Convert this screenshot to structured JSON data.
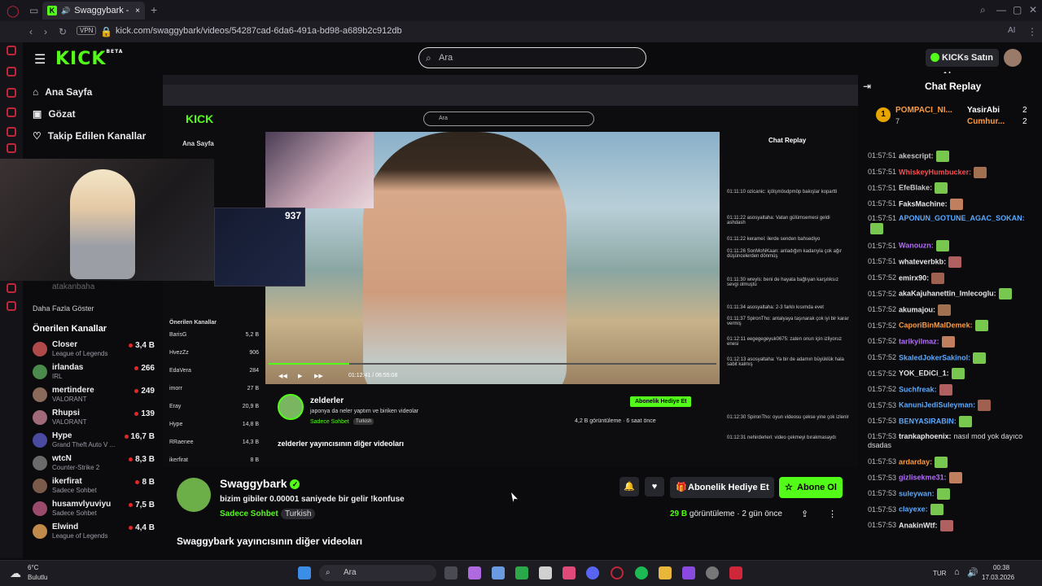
{
  "browser": {
    "tab_title": "Swaggybark - Watch th",
    "vpn_label": "VPN",
    "url": "kick.com/swaggybark/videos/54287cad-6da6-491a-bd98-a689b2c912db",
    "ai_label": "AI"
  },
  "header": {
    "logo": "KICK",
    "logo_beta": "BETA",
    "search_placeholder": "Ara",
    "kicks_button": "KICKs Satın Al"
  },
  "sidebar": {
    "nav": [
      {
        "label": "Ana Sayfa",
        "icon": "home-icon"
      },
      {
        "label": "Gözat",
        "icon": "browse-icon"
      },
      {
        "label": "Takip Edilen Kanallar",
        "icon": "heart-icon"
      }
    ],
    "followed_user": "atakanbaha",
    "show_more": "Daha Fazla Göster",
    "recommended_title": "Önerilen Kanallar",
    "channels": [
      {
        "name": "Closer",
        "game": "League of Legends",
        "viewers": "3,4 B"
      },
      {
        "name": "irlandas",
        "game": "IRL",
        "viewers": "266"
      },
      {
        "name": "mertindere",
        "game": "VALORANT",
        "viewers": "249"
      },
      {
        "name": "Rhupsi",
        "game": "VALORANT",
        "viewers": "139"
      },
      {
        "name": "Hype",
        "game": "Grand Theft Auto V ...",
        "viewers": "16,7 B"
      },
      {
        "name": "wtcN",
        "game": "Counter-Strike 2",
        "viewers": "8,3 B"
      },
      {
        "name": "ikerfirat",
        "game": "Sadece Sohbet",
        "viewers": "8 B"
      },
      {
        "name": "husamvlyuviyu",
        "game": "Sadece Sohbet",
        "viewers": "7,5 B"
      },
      {
        "name": "Elwind",
        "game": "League of Legends",
        "viewers": "4,4 B"
      }
    ]
  },
  "inner": {
    "search": "Ara",
    "nav1": "Ana Sayfa",
    "pip_count": "937",
    "time": "01:12:41 / 06:55:08",
    "title": "zelderler",
    "subtitle": "japonya da neler yaptım ve biriken videolar",
    "category": "Sadece Sohbet",
    "tag": "Turkish",
    "stats": "4,2 B görüntüleme · 6 saat önce",
    "gift_button": "Abonelik Hediye Et",
    "more_videos": "zelderler yayıncısının diğer videoları",
    "chat_title": "Chat Replay",
    "recommended": "Önerilen Kanallar",
    "inner_channels": [
      {
        "name": "BarisG",
        "viewers": "5,2 B"
      },
      {
        "name": "HvezZz",
        "viewers": "906"
      },
      {
        "name": "EdaVera",
        "viewers": "284"
      },
      {
        "name": "imorr",
        "viewers": "27 B"
      },
      {
        "name": "Eray",
        "viewers": "20,9 B"
      },
      {
        "name": "Hype",
        "viewers": "14,8 B"
      },
      {
        "name": "RRaenee",
        "viewers": "14,3 B"
      },
      {
        "name": "ikerfirat",
        "viewers": "8 B"
      }
    ],
    "chat_lines": [
      "01:11:10 ozicanic: içölşmösdpmöp bakışlar kopartti",
      "01:11:22 asosyaltaha: Vatan gülümsemesi geldi ashdash",
      "01:11:22 keramei: ilerde senden bahsediyo",
      "01:11:26 SonMohiKaan: anladığım kadarıyla çok ağır düşüncelerden dönmüş",
      "01:11:30 wreyls: beni de hayata bağlıyan karşılıksız sevgi olmuştu",
      "01:11:34 asosyaltaha: 2-3 farklı kısımda evet",
      "01:11:37 SpironTho: antalyaya taşınarak çok iyi bir karar vermiş",
      "01:12:11 eegegegeyuk0675: zaten onun için izliyoruz enesi",
      "01:12:13 asosyaltaha: Ya bir de adamın büyüklük hala sabit kalmış",
      "01:12:30 SpironTho: oyun videosu çekse yine çok izlenir",
      "01:12:31 nehirderleri: video çekmeyi bırakmasaydı"
    ]
  },
  "channel": {
    "name": "Swaggybark",
    "description": "bizim gibiler 0.00001 saniyede bir gelir !konfuse",
    "category": "Sadece Sohbet",
    "tag": "Turkish",
    "gift_button": "Abonelik Hediye Et",
    "subscribe_button": "Abone Ol",
    "views_count": "29 B",
    "views_label": "görüntüleme",
    "time_ago": "2 gün önce",
    "more_videos": "Swaggybark yayıncısının diğer videoları"
  },
  "chat": {
    "title": "Chat Replay",
    "pinned": [
      {
        "name": "POMPACI_NI...",
        "count": "7"
      },
      {
        "name": "YasirAbi",
        "count": "2"
      },
      {
        "name": "Cumhur...",
        "count": "2"
      }
    ],
    "messages": [
      {
        "time": "01:57:51",
        "user": "akescript:",
        "color": "#c8c8c8",
        "text": ""
      },
      {
        "time": "01:57:51",
        "user": "WhiskeyHumbucker:",
        "color": "#ff4d4d",
        "text": ""
      },
      {
        "time": "01:57:51",
        "user": "EfeBlake:",
        "color": "#c8c8c8",
        "text": ""
      },
      {
        "time": "01:57:51",
        "user": "FaksMachine:",
        "color": "#e8e8e8",
        "text": ""
      },
      {
        "time": "01:57:51",
        "user": "APONUN_GOTUNE_AGAC_SOKAN:",
        "color": "#5aa9ff",
        "text": ""
      },
      {
        "time": "01:57:51",
        "user": "Wanouzn:",
        "color": "#b36bff",
        "text": ""
      },
      {
        "time": "01:57:51",
        "user": "whateverbkb:",
        "color": "#e8e8e8",
        "text": ""
      },
      {
        "time": "01:57:52",
        "user": "emirx90:",
        "color": "#e8e8e8",
        "text": ""
      },
      {
        "time": "01:57:52",
        "user": "akaKajuhanettin_lmlecoglu:",
        "color": "#e8e8e8",
        "text": ""
      },
      {
        "time": "01:57:52",
        "user": "akumajou:",
        "color": "#e8e8e8",
        "text": ""
      },
      {
        "time": "01:57:52",
        "user": "CaporiBinMalDemek:",
        "color": "#ff9a3d",
        "text": ""
      },
      {
        "time": "01:57:52",
        "user": "tarikyilmaz:",
        "color": "#b36bff",
        "text": ""
      },
      {
        "time": "01:57:52",
        "user": "SkaledJokerSakinol:",
        "color": "#5aa9ff",
        "text": ""
      },
      {
        "time": "01:57:52",
        "user": "YOK_EDiCi_1:",
        "color": "#e8e8e8",
        "text": ""
      },
      {
        "time": "01:57:52",
        "user": "Suchfreak:",
        "color": "#5aa9ff",
        "text": ""
      },
      {
        "time": "01:57:53",
        "user": "KanuniJediSuleyman:",
        "color": "#5aa9ff",
        "text": ""
      },
      {
        "time": "01:57:53",
        "user": "BENYASIRABIN:",
        "color": "#5aa9ff",
        "text": ""
      },
      {
        "time": "01:57:53",
        "user": "trankaphoenix:",
        "color": "#e8e8e8",
        "text": "nasıl mod yok dayıco dsadas"
      },
      {
        "time": "01:57:53",
        "user": "ardarday:",
        "color": "#ff9a3d",
        "text": ""
      },
      {
        "time": "01:57:53",
        "user": "gizlisekme31:",
        "color": "#b36bff",
        "text": ""
      },
      {
        "time": "01:57:53",
        "user": "suleywan:",
        "color": "#5aa9ff",
        "text": ""
      },
      {
        "time": "01:57:53",
        "user": "clayexe:",
        "color": "#5aa9ff",
        "text": ""
      },
      {
        "time": "01:57:53",
        "user": "AnakinWtf:",
        "color": "#e8e8e8",
        "text": ""
      }
    ]
  },
  "taskbar": {
    "weather_temp": "6°C",
    "weather_desc": "Bulutlu",
    "search": "Ara",
    "lang": "TUR",
    "time": "00:38",
    "date": "17.03.2026"
  },
  "colors": {
    "kick_green": "#53fc18",
    "opera_red": "#c0263a",
    "bg": "#0b0b0e"
  }
}
